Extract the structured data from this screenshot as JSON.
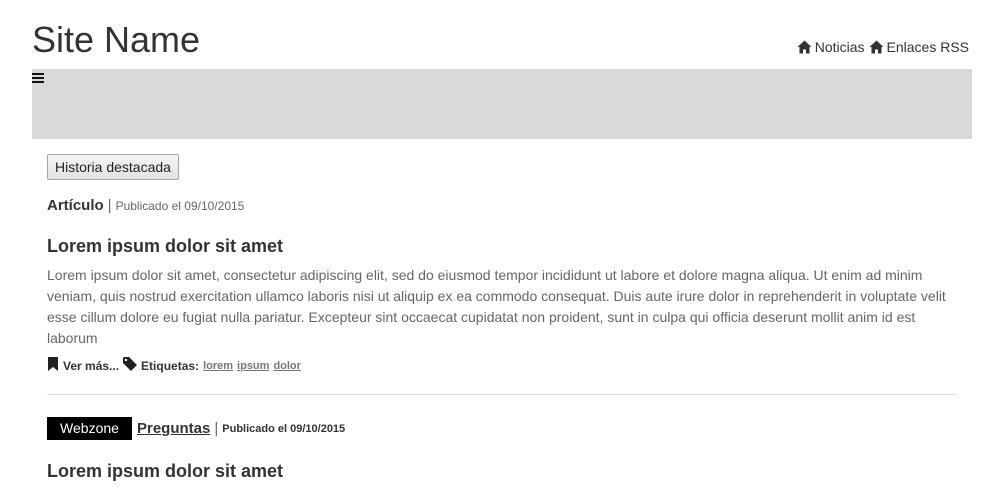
{
  "header": {
    "site_name": "Site Name",
    "links": [
      {
        "label": "Noticias",
        "icon": "home-icon"
      },
      {
        "label": "Enlaces RSS",
        "icon": "home-icon"
      }
    ]
  },
  "navbar": {
    "background": "#d9d9d9",
    "toggle_icon": "hamburger-icon"
  },
  "featured": {
    "button_label": "Historia destacada"
  },
  "articles": [
    {
      "type": "Artículo",
      "separator": "|",
      "published": "Publicado el 09/10/2015",
      "title": "Lorem ipsum dolor sit amet",
      "body": "Lorem ipsum dolor sit amet, consectetur adipiscing elit, sed do eiusmod tempor incididunt ut labore et dolore magna aliqua. Ut enim ad minim veniam, quis nostrud exercitation ullamco laboris nisi ut aliquip ex ea commodo consequat. Duis aute irure dolor in reprehenderit in voluptate velit esse cillum dolore eu fugiat nulla pariatur. Excepteur sint occaecat cupidatat non proident, sunt in culpa qui officia deserunt mollit anim id est laborum",
      "read_more": "Ver más...",
      "tags_label": "Etiquetas:",
      "tags": [
        "lorem",
        "ipsum",
        "dolor"
      ]
    },
    {
      "badge": "Webzone",
      "section": "Preguntas",
      "separator": "|",
      "published": "Publicado el 09/10/2015",
      "title": "Lorem ipsum dolor sit amet"
    }
  ]
}
